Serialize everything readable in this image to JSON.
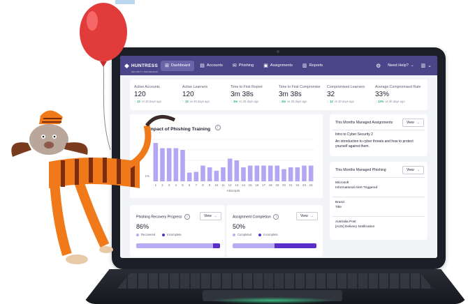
{
  "app": {
    "logo": "HUNTRESS",
    "logo_sub": "SECURITY AWARENESS"
  },
  "nav": {
    "items": [
      {
        "label": "Dashboard",
        "icon": "dashboard-icon",
        "glyph": "⊞"
      },
      {
        "label": "Accounts",
        "icon": "accounts-icon",
        "glyph": "▤"
      },
      {
        "label": "Phishing",
        "icon": "mail-icon",
        "glyph": "✉"
      },
      {
        "label": "Assignments",
        "icon": "briefcase-icon",
        "glyph": "▣"
      },
      {
        "label": "Reports",
        "icon": "reports-icon",
        "glyph": "▥"
      }
    ],
    "help": "Need Help?",
    "caret": "⌄"
  },
  "stats": [
    {
      "label": "Active Accounts",
      "value": "120",
      "delta": "13",
      "arrow": "↑",
      "note": "vs 30 days ago"
    },
    {
      "label": "Active Learners",
      "value": "120",
      "delta": "13",
      "arrow": "↑",
      "note": "vs 30 days ago"
    },
    {
      "label": "Time to First Report",
      "value": "3m 38s",
      "delta": "3m",
      "arrow": "↓",
      "note": "vs 30 days ago"
    },
    {
      "label": "Time to First Compromise",
      "value": "3m 38s",
      "delta": "3m",
      "arrow": "↓",
      "note": "vs 30 days ago"
    },
    {
      "label": "Compromised Learners",
      "value": "32",
      "delta": "13",
      "arrow": "↓",
      "note": "vs 30 days ago"
    },
    {
      "label": "Average Compromised Rate",
      "value": "33%",
      "delta": "13%",
      "arrow": "↓",
      "note": "vs 30 days ago"
    }
  ],
  "impact": {
    "title": "Impact of Phishing Training",
    "info": "i"
  },
  "chart_data": {
    "type": "bar",
    "title": "Impact of Phishing Training",
    "xlabel": "Attempts",
    "ylabel": "",
    "categories": [
      "1",
      "2",
      "3",
      "4",
      "5",
      "6",
      "7",
      "8",
      "9",
      "10",
      "11",
      "12",
      "13",
      "14",
      "15",
      "16",
      "17",
      "18",
      "19",
      "20",
      "21",
      "22",
      "23",
      "24"
    ],
    "values": [
      11,
      9.5,
      9.5,
      9.5,
      9,
      2.5,
      2.7,
      4.5,
      4,
      3,
      4,
      6.5,
      6,
      4,
      4.5,
      4.5,
      4.5,
      4.5,
      4.5,
      3.5,
      4,
      4,
      4.5,
      4.5
    ],
    "y_ticks": [
      "5%",
      "1%"
    ],
    "color": "#b4a6f3",
    "grid": true
  },
  "recovery": {
    "title": "Phishing Recovery Progress",
    "info": "i",
    "value": "86%",
    "fraction": 0.92,
    "legend_a": "Recovered",
    "legend_b": "Incomplete",
    "view": "View"
  },
  "completion": {
    "title": "Assignment Completion",
    "info": "i",
    "value": "50%",
    "fraction": 0.5,
    "legend_a": "Completed",
    "legend_b": "Incomplete",
    "view": "View"
  },
  "assignments": {
    "title": "This Months Managed Assignments",
    "view": "View",
    "course": "Intro to Cyber Security 2",
    "description": "An introduction to cyber threats and how to protect yourself against them."
  },
  "phishing": {
    "title": "This Months Managed Phishing",
    "view": "View",
    "rows": [
      {
        "line1": "Microsoft",
        "line2": "Informational Alert Triggered"
      },
      {
        "line1": "Brand",
        "line2": "Title"
      },
      {
        "line1": "Australia Post",
        "line2": "[AUS] Delivery Notification"
      }
    ]
  },
  "colors": {
    "topbar": "#4b4589",
    "accent": "#5a2fc9",
    "bar": "#b4a6f3",
    "positive": "#22b07d",
    "balloon": "#e23b3b",
    "mascot_orange": "#f07a1a"
  }
}
